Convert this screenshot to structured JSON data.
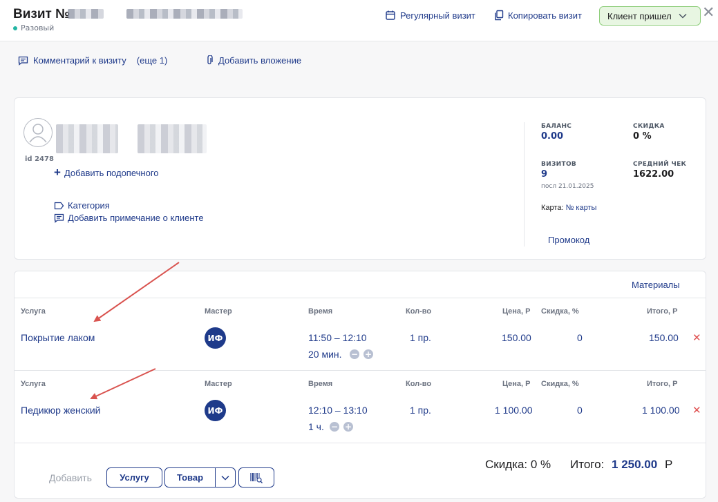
{
  "header": {
    "title": "Визит №",
    "visit_type": "Разовый",
    "regular_visit": "Регулярный визит",
    "copy_visit": "Копировать визит",
    "status": "Клиент пришел"
  },
  "actions": {
    "comment": "Комментарий к визиту",
    "comment_more": "(еще 1)",
    "attachment": "Добавить вложение"
  },
  "client": {
    "id": "id 2478",
    "add_dependent": "Добавить подопечного",
    "category": "Категория",
    "add_note": "Добавить примечание о клиенте",
    "balance_label": "БАЛАНС",
    "balance": "0.00",
    "discount_label": "СКИДКА",
    "discount": "0 %",
    "visits_label": "ВИЗИТОВ",
    "visits": "9",
    "last_visit": "посл 21.01.2025",
    "avg_check_label": "СРЕДНИЙ ЧЕК",
    "avg_check": "1622.00",
    "card_label": "Карта:",
    "card_value": "№ карты",
    "promo": "Промокод"
  },
  "services": {
    "materials": "Материалы",
    "columns": [
      "Услуга",
      "Мастер",
      "Время",
      "Кол-во",
      "Цена, Р",
      "Скидка, %",
      "Итого, Р"
    ],
    "rows": [
      {
        "name": "Покрытие лаком",
        "master": "ИФ",
        "time": "11:50 – 12:10",
        "duration": "20 мин.",
        "qty": "1 пр.",
        "price": "150.00",
        "discount": "0",
        "total": "150.00"
      },
      {
        "name": "Педикюр женский",
        "master": "ИФ",
        "time": "12:10 – 13:10",
        "duration": "1 ч.",
        "qty": "1 пр.",
        "price": "1 100.00",
        "discount": "0",
        "total": "1 100.00"
      }
    ],
    "discount_summary_label": "Скидка:",
    "discount_summary": "0 %",
    "total_label": "Итого:",
    "total": "1 250.00",
    "currency": "Р",
    "add_label": "Добавить",
    "add_service": "Услугу",
    "add_product": "Товар"
  },
  "colors": {
    "accent": "#1f3a8a",
    "status_green": "#8fce7c",
    "delete_red": "#e05252",
    "annotation_arrow": "#d9534f"
  }
}
